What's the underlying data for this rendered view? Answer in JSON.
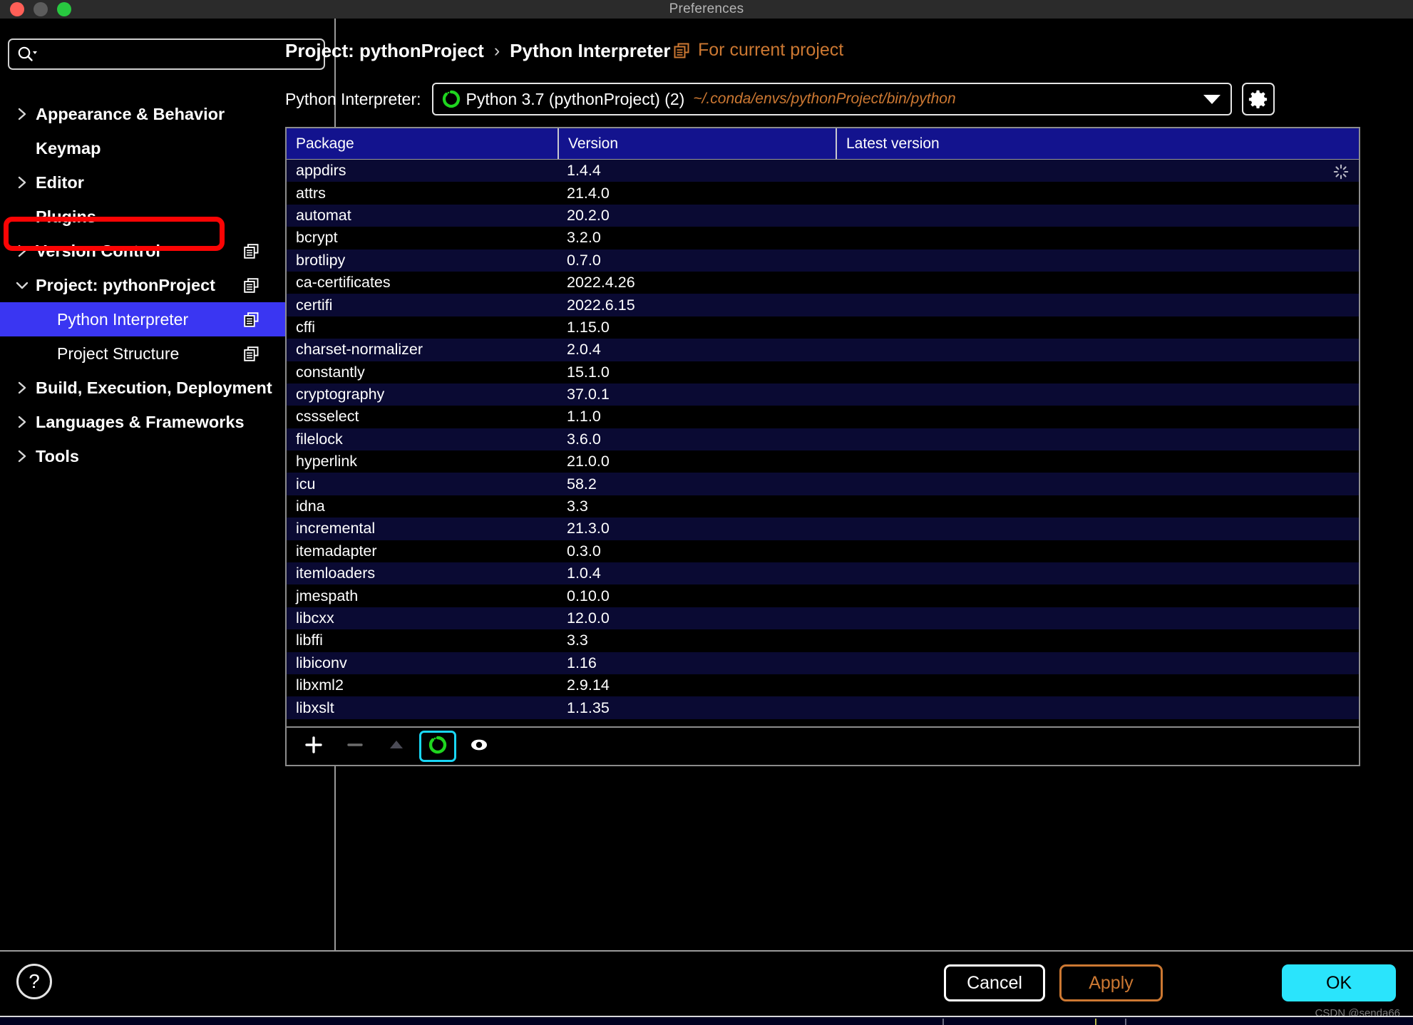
{
  "window": {
    "title": "Preferences",
    "traffic_lights": [
      "close-red",
      "minimize-gray",
      "maximize-green"
    ]
  },
  "sidebar": {
    "search": {
      "placeholder": "",
      "value": "",
      "icon": "search-icon"
    },
    "items": [
      {
        "label": "Appearance & Behavior",
        "level": 0,
        "arrow": "chevron-right",
        "copy_icon": false,
        "selected": false
      },
      {
        "label": "Keymap",
        "level": 0,
        "arrow": "none",
        "copy_icon": false,
        "selected": false
      },
      {
        "label": "Editor",
        "level": 0,
        "arrow": "chevron-right",
        "copy_icon": false,
        "selected": false
      },
      {
        "label": "Plugins",
        "level": 0,
        "arrow": "none",
        "copy_icon": false,
        "selected": false
      },
      {
        "label": "Version Control",
        "level": 0,
        "arrow": "chevron-right",
        "copy_icon": true,
        "selected": false
      },
      {
        "label": "Project: pythonProject",
        "level": 0,
        "arrow": "chevron-down",
        "copy_icon": true,
        "selected": false,
        "annotated": true
      },
      {
        "label": "Python Interpreter",
        "level": 1,
        "arrow": "none",
        "copy_icon": true,
        "selected": true
      },
      {
        "label": "Project Structure",
        "level": 1,
        "arrow": "none",
        "copy_icon": true,
        "selected": false
      },
      {
        "label": "Build, Execution, Deployment",
        "level": 0,
        "arrow": "chevron-right",
        "copy_icon": false,
        "selected": false
      },
      {
        "label": "Languages & Frameworks",
        "level": 0,
        "arrow": "chevron-right",
        "copy_icon": false,
        "selected": false
      },
      {
        "label": "Tools",
        "level": 0,
        "arrow": "chevron-right",
        "copy_icon": false,
        "selected": false
      }
    ]
  },
  "header": {
    "breadcrumb": {
      "parent": "Project: pythonProject",
      "separator": "›",
      "current": "Python Interpreter"
    },
    "for_current_project": {
      "label": "For current project",
      "icon": "copy-icon",
      "color": "#cc7832"
    }
  },
  "interpreter": {
    "label": "Python Interpreter:",
    "selected_name": "Python 3.7 (pythonProject) (2)",
    "selected_path": "~/.conda/envs/pythonProject/bin/python",
    "status_icon": "loading-spinner-icon",
    "dropdown_icon": "chevron-down-icon",
    "settings_icon": "gear-icon"
  },
  "packages_table": {
    "columns": [
      "Package",
      "Version",
      "Latest version"
    ],
    "loading_row_index": 0,
    "rows": [
      {
        "package": "appdirs",
        "version": "1.4.4",
        "latest": ""
      },
      {
        "package": "attrs",
        "version": "21.4.0",
        "latest": ""
      },
      {
        "package": "automat",
        "version": "20.2.0",
        "latest": ""
      },
      {
        "package": "bcrypt",
        "version": "3.2.0",
        "latest": ""
      },
      {
        "package": "brotlipy",
        "version": "0.7.0",
        "latest": ""
      },
      {
        "package": "ca-certificates",
        "version": "2022.4.26",
        "latest": ""
      },
      {
        "package": "certifi",
        "version": "2022.6.15",
        "latest": ""
      },
      {
        "package": "cffi",
        "version": "1.15.0",
        "latest": ""
      },
      {
        "package": "charset-normalizer",
        "version": "2.0.4",
        "latest": ""
      },
      {
        "package": "constantly",
        "version": "15.1.0",
        "latest": ""
      },
      {
        "package": "cryptography",
        "version": "37.0.1",
        "latest": ""
      },
      {
        "package": "cssselect",
        "version": "1.1.0",
        "latest": ""
      },
      {
        "package": "filelock",
        "version": "3.6.0",
        "latest": ""
      },
      {
        "package": "hyperlink",
        "version": "21.0.0",
        "latest": ""
      },
      {
        "package": "icu",
        "version": "58.2",
        "latest": ""
      },
      {
        "package": "idna",
        "version": "3.3",
        "latest": ""
      },
      {
        "package": "incremental",
        "version": "21.3.0",
        "latest": ""
      },
      {
        "package": "itemadapter",
        "version": "0.3.0",
        "latest": ""
      },
      {
        "package": "itemloaders",
        "version": "1.0.4",
        "latest": ""
      },
      {
        "package": "jmespath",
        "version": "0.10.0",
        "latest": ""
      },
      {
        "package": "libcxx",
        "version": "12.0.0",
        "latest": ""
      },
      {
        "package": "libffi",
        "version": "3.3",
        "latest": ""
      },
      {
        "package": "libiconv",
        "version": "1.16",
        "latest": ""
      },
      {
        "package": "libxml2",
        "version": "2.9.14",
        "latest": ""
      },
      {
        "package": "libxslt",
        "version": "1.1.35",
        "latest": ""
      }
    ]
  },
  "table_toolbar": {
    "buttons": [
      {
        "name": "add-package-button",
        "icon": "plus-icon",
        "focused": false
      },
      {
        "name": "remove-package-button",
        "icon": "minus-icon",
        "focused": false
      },
      {
        "name": "upgrade-package-button",
        "icon": "up-arrow-icon",
        "focused": false
      },
      {
        "name": "loading-indicator",
        "icon": "loading-spinner-icon",
        "focused": true
      },
      {
        "name": "show-early-releases-button",
        "icon": "eye-icon",
        "focused": false
      }
    ]
  },
  "footer": {
    "help_label": "?",
    "cancel_label": "Cancel",
    "apply_label": "Apply",
    "ok_label": "OK",
    "watermark": "CSDN @senda66"
  },
  "colors": {
    "selection_blue": "#3a36f2",
    "header_blue": "#13138e",
    "row_alt": "#0a0a33",
    "accent_orange": "#cc7832",
    "ok_cyan": "#2ae4fc",
    "annotation_red": "#fb0404"
  }
}
